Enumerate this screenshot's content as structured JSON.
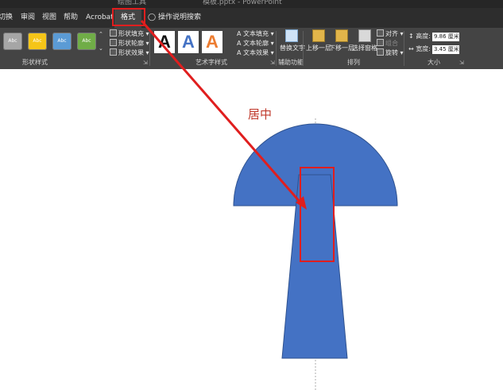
{
  "title_bar": {
    "context_tab": "绘图工具",
    "window_title": "模板.pptx - PowerPoint"
  },
  "tabs": [
    {
      "label": "切换"
    },
    {
      "label": "审阅"
    },
    {
      "label": "视图"
    },
    {
      "label": "帮助"
    },
    {
      "label": "Acrobat"
    },
    {
      "label": "格式",
      "active": true
    }
  ],
  "tell_me": {
    "label": "操作说明搜索",
    "icon": "lightbulb-icon"
  },
  "ribbon": {
    "shape_styles": {
      "label": "形状样式",
      "presets": [
        {
          "text": "Abc",
          "color": "#a6a6a6"
        },
        {
          "text": "Abc",
          "color": "#f5c518"
        },
        {
          "text": "Abc",
          "color": "#5b9bd5"
        },
        {
          "text": "Abc",
          "color": "#70ad47"
        }
      ],
      "fill": "形状填充",
      "outline": "形状轮廓",
      "effects": "形状效果"
    },
    "wordart_styles": {
      "label": "艺术字样式",
      "samples": [
        {
          "text": "A",
          "color": "#111111"
        },
        {
          "text": "A",
          "color": "#4472c4"
        },
        {
          "text": "A",
          "color": "#ed7d31"
        }
      ],
      "text_fill": "文本填充",
      "text_outline": "文本轮廓",
      "text_effects": "文本效果"
    },
    "accessibility": {
      "label": "辅助功能",
      "alt_text": "替换文字"
    },
    "arrange": {
      "label": "排列",
      "bring_forward": "上移一层",
      "send_backward": "下移一层",
      "selection_pane": "选择窗格",
      "align": "对齐",
      "group": "组合",
      "rotate": "旋转"
    },
    "size": {
      "label": "大小",
      "height_label": "高度:",
      "height_value": "9.86 厘米",
      "width_label": "宽度:",
      "width_value": "3.45 厘米"
    }
  },
  "slide": {
    "caption": "居中"
  },
  "colors": {
    "shape_fill": "#4472c4",
    "shape_stroke": "#2f528f",
    "annotation_red": "#e01e1e",
    "caption_red": "#c0392b"
  }
}
